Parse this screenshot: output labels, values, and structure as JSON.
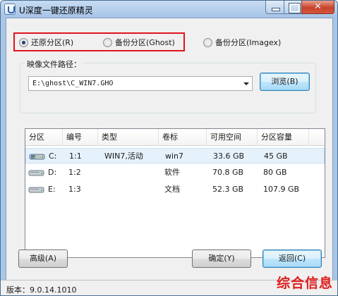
{
  "window": {
    "title": "U深度一键还原精灵"
  },
  "restore_options": [
    {
      "label": "还原分区(R)",
      "checked": true
    },
    {
      "label": "备份分区(Ghost)",
      "checked": false
    },
    {
      "label": "备份分区(Imagex)",
      "checked": false
    }
  ],
  "image_path": {
    "group_label": "映像文件路径：",
    "value": "E:\\ghost\\C_WIN7.GHO",
    "browse_label": "浏览(B)"
  },
  "partition_table": {
    "columns": [
      "分区",
      "编号",
      "类型",
      "卷标",
      "可用空间",
      "分区容量"
    ],
    "rows": [
      {
        "drive": "C:",
        "number": "1:1",
        "type": "WIN7,活动",
        "label": "win7",
        "free": "33.6 GB",
        "capacity": "45 GB",
        "selected": true
      },
      {
        "drive": "D:",
        "number": "1:2",
        "type": "",
        "label": "软件",
        "free": "70.8 GB",
        "capacity": "80 GB",
        "selected": false
      },
      {
        "drive": "E:",
        "number": "1:3",
        "type": "",
        "label": "文档",
        "free": "52.3 GB",
        "capacity": "107.9 GB",
        "selected": false
      }
    ]
  },
  "buttons": {
    "advanced": "高级(A)",
    "ok": "确定(Y)",
    "back": "返回(C)"
  },
  "status": {
    "version": "版本：9.0.14.1010"
  },
  "watermark": "综合信息"
}
